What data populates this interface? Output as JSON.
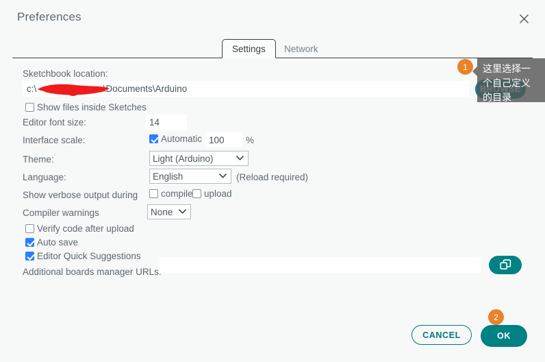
{
  "window": {
    "title": "Preferences",
    "close_icon": "close-icon"
  },
  "tabs": [
    {
      "label": "Settings",
      "active": true
    },
    {
      "label": "Network",
      "active": false
    }
  ],
  "settings": {
    "sketchbook_label": "Sketchbook location:",
    "sketchbook_value": "c:\\                          \\Documents\\Arduino",
    "sketchbook_value_visible_prefix": "c:\\",
    "sketchbook_value_visible_suffix": "\\Documents\\Arduino",
    "browse_label": "BROWSE",
    "show_files_label": "Show files inside Sketches",
    "show_files_checked": false,
    "font_size_label": "Editor font size:",
    "font_size_value": "14",
    "interface_scale_label": "Interface scale:",
    "automatic_label": "Automatic",
    "automatic_checked": true,
    "scale_value": "100",
    "percent_label": "%",
    "theme_label": "Theme:",
    "theme_value": "Light (Arduino)",
    "theme_options": [
      "Light (Arduino)"
    ],
    "language_label": "Language:",
    "language_value": "English",
    "language_options": [
      "English"
    ],
    "reload_note": "(Reload required)",
    "verbose_label": "Show verbose output during",
    "compile_label": "compile",
    "compile_checked": false,
    "upload_label": "upload",
    "upload_checked": false,
    "compiler_warnings_label": "Compiler warnings",
    "compiler_warnings_value": "None",
    "compiler_warnings_options": [
      "None"
    ],
    "verify_label": "Verify code after upload",
    "verify_checked": false,
    "autosave_label": "Auto save",
    "autosave_checked": true,
    "quick_suggestions_label": "Editor Quick Suggestions",
    "quick_suggestions_checked": true,
    "boards_urls_label": "Additional boards manager URLs:",
    "boards_urls_value": "",
    "boards_urls_icon": "open-window-icon"
  },
  "footer": {
    "cancel_label": "CANCEL",
    "ok_label": "OK"
  },
  "annotations": {
    "badge_one": "1",
    "badge_two": "2",
    "tooltip_text": "这里选择一个自己定义的目录"
  },
  "colors": {
    "accent_teal": "#008184",
    "badge_orange": "#e8832a",
    "checkbox_blue": "#2a7fff",
    "page_bg": "#f7f8f8",
    "field_bg": "#ffffff",
    "text": "#5b6a70",
    "redaction_red": "#f01b1b"
  }
}
